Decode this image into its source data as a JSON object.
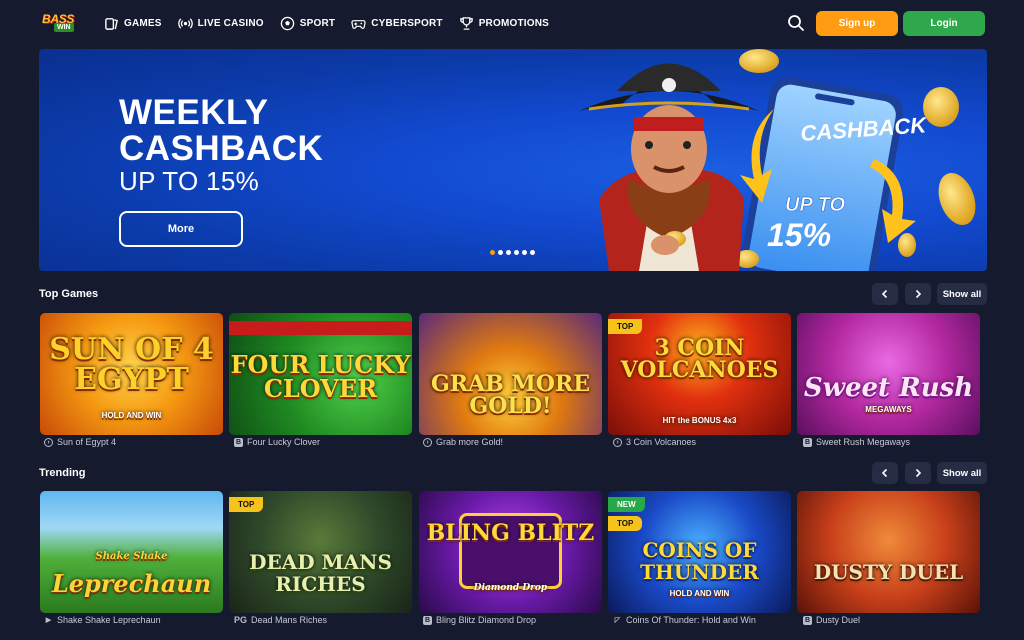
{
  "header": {
    "logo_top": "BASS",
    "logo_bottom": "WIN",
    "nav": [
      {
        "label": "GAMES",
        "icon": "cards-icon"
      },
      {
        "label": "LIVE CASINO",
        "icon": "broadcast-icon"
      },
      {
        "label": "SPORT",
        "icon": "soccer-ball-icon"
      },
      {
        "label": "CYBERSPORT",
        "icon": "gamepad-icon"
      },
      {
        "label": "PROMOTIONS",
        "icon": "trophy-icon"
      }
    ],
    "signup_label": "Sign up",
    "login_label": "Login"
  },
  "banner": {
    "title_line1": "WEEKLY",
    "title_line2": "CASHBACK",
    "subtitle": "UP TO 15%",
    "button_label": "More",
    "art_phone_text": "CASHBACK",
    "art_upto": "UP TO",
    "art_percent": "15%",
    "slide_count": 6,
    "active_slide": 1
  },
  "top_games": {
    "title": "Top Games",
    "show_all": "Show all",
    "items": [
      {
        "name": "Sun of Egypt 4",
        "art_title": "SUN OF 4 EGYPT",
        "art_sub": "HOLD AND WIN",
        "badge": "",
        "provider": "circ"
      },
      {
        "name": "Four Lucky Clover",
        "art_title": "FOUR LUCKY CLOVER",
        "art_sub": "",
        "badge": "",
        "provider": "box"
      },
      {
        "name": "Grab more Gold!",
        "art_title": "GRAB MORE GOLD!",
        "art_sub": "",
        "badge": "",
        "provider": "circ"
      },
      {
        "name": "3 Coin Volcanoes",
        "art_title": "3 COIN VOLCANOES",
        "art_sub": "HIT the BONUS 4x3",
        "badge": "TOP",
        "provider": "circ"
      },
      {
        "name": "Sweet Rush Megaways",
        "art_title": "Sweet Rush",
        "art_sub": "MEGAWAYS",
        "badge": "",
        "provider": "box"
      }
    ]
  },
  "trending": {
    "title": "Trending",
    "show_all": "Show all",
    "items": [
      {
        "name": "Shake Shake Leprechaun",
        "art_title": "Leprechaun",
        "art_sub": "Shake Shake",
        "badge": "",
        "badge2": "",
        "provider": "tri"
      },
      {
        "name": "Dead Mans Riches",
        "art_title": "DEAD MANS RICHES",
        "art_sub": "",
        "badge": "TOP",
        "badge2": "",
        "provider": "pg"
      },
      {
        "name": "Bling Blitz Diamond Drop",
        "art_title": "BLING BLITZ",
        "art_sub": "Diamond Drop",
        "badge": "",
        "badge2": "",
        "provider": "box"
      },
      {
        "name": "Coins Of Thunder: Hold and Win",
        "art_title": "COINS OF THUNDER",
        "art_sub": "HOLD AND WIN",
        "badge": "NEW",
        "badge2": "TOP",
        "provider": "flag"
      },
      {
        "name": "Dusty Duel",
        "art_title": "DUSTY DUEL",
        "art_sub": "",
        "badge": "",
        "badge2": "",
        "provider": "box"
      }
    ]
  },
  "colors": {
    "background": "#161a2e",
    "signup": "#ff9c12",
    "login": "#2ea84a",
    "banner": "#124ad0",
    "badge_top": "#f6c31b",
    "badge_new": "#27a84a"
  }
}
